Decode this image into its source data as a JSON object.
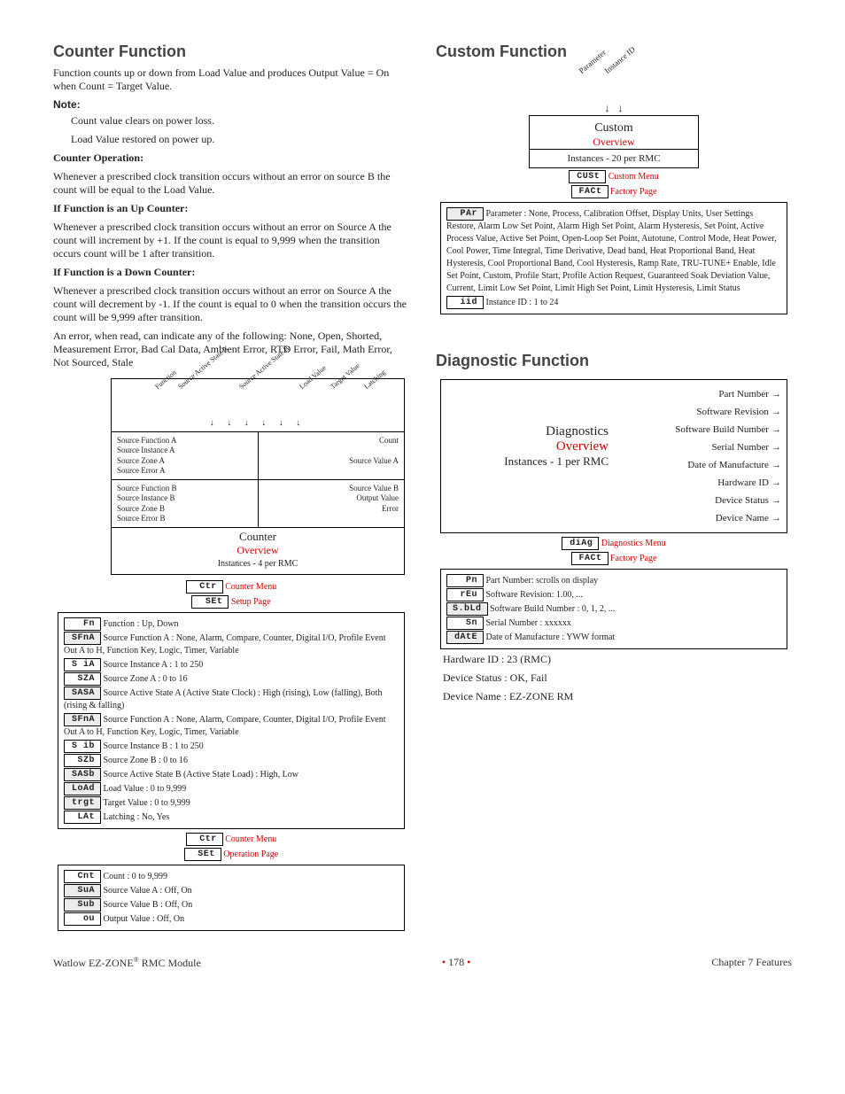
{
  "left": {
    "title": "Counter Function",
    "intro": "Function counts up or down from Load Value and produces Output Value = On when Count = Target Value.",
    "noteLabel": "Note:",
    "note1": "Count value clears on power loss.",
    "note2": "Load Value restored on power up.",
    "h1": "Counter Operation:",
    "p1": "Whenever a prescribed clock transition occurs without an error on source B the count will be equal to the Load Value.",
    "h2": "If Function is an Up Counter:",
    "p2": "Whenever a prescribed clock transition occurs without an error on Source A the count will increment by +1. If the count is equal to 9,999 when the transition occurs count will be 1 after transition.",
    "h3": "If Function is a Down Counter:",
    "p3": "Whenever a prescribed clock transition occurs without an error on Source A the count will decrement by -1. If the count is equal to 0 when the transition occurs the count will be 9,999 after transition.",
    "p4": "An error, when read, can indicate any of the following: None, Open, Shorted, Measurement Error, Bad Cal Data, Ambient Error, RTD Error, Fail, Math Error, Not Sourced, Stale",
    "diagram": {
      "topLabels": {
        "a": "Function",
        "b": "Source Active State A",
        "c": "Source Active State B",
        "d": "Load Value",
        "e": "Target Value",
        "f": "Latching"
      },
      "left1": "Source Function A\nSource Instance A\nSource Zone A\nSource Error A",
      "right1": "Count\n\nSource Value A",
      "left2": "Source Function B\nSource Instance B\nSource Zone B\nSource Error B",
      "right2": "Source Value B\nOutput Value\nError",
      "title": "Counter",
      "overview": "Overview",
      "instances": "Instances - 4 per RMC"
    },
    "menu1": {
      "seg1": "Ctr",
      "label1": "Counter Menu",
      "seg2": "SEt",
      "label2": "Setup Page"
    },
    "params1": {
      "r1": {
        "seg": "Fn",
        "txt": "Function : Up, Down"
      },
      "r2": {
        "seg": "SFnA",
        "txt": "Source Function A : None, Alarm, Compare, Counter, Digital I/O, Profile Event Out A to H, Function Key, Logic, Timer, Variable"
      },
      "r3": {
        "seg": "S iA",
        "txt": "Source Instance A : 1 to 250"
      },
      "r4": {
        "seg": "SZA",
        "txt": "Source Zone A : 0 to 16"
      },
      "r5": {
        "seg": "SASA",
        "txt": "Source Active State A (Active State Clock) : High (rising), Low (falling), Both (rising & falling)"
      },
      "r6": {
        "seg": "SFnA",
        "txt": "Source Function A : None, Alarm, Compare, Counter, Digital I/O, Profile Event Out A to H, Function Key, Logic, Timer, Variable"
      },
      "r7": {
        "seg": "S ib",
        "txt": "Source Instance B : 1 to 250"
      },
      "r8": {
        "seg": "SZb",
        "txt": "Source Zone B : 0 to 16"
      },
      "r9": {
        "seg": "SASb",
        "txt": "Source Active State B (Active State Load) : High, Low"
      },
      "r10": {
        "seg": "LoAd",
        "txt": "Load Value : 0 to 9,999"
      },
      "r11": {
        "seg": "trgt",
        "txt": "Target Value : 0 to 9,999"
      },
      "r12": {
        "seg": "LAt",
        "txt": "Latching : No, Yes"
      }
    },
    "menu2": {
      "seg1": "Ctr",
      "label1": "Counter Menu",
      "seg2": "SEt",
      "label2": "Operation Page"
    },
    "params2": {
      "r1": {
        "seg": "Cnt",
        "txt": "Count : 0 to 9,999"
      },
      "r2": {
        "seg": "SuA",
        "txt": "Source Value A : Off, On"
      },
      "r3": {
        "seg": "Sub",
        "txt": "Source Value B : Off, On"
      },
      "r4": {
        "seg": "ou",
        "txt": "Output Value : Off, On"
      }
    }
  },
  "right": {
    "custom": {
      "title": "Custom Function",
      "topLabels": {
        "a": "Parameter",
        "b": "Instance ID"
      },
      "boxTitle": "Custom",
      "overview": "Overview",
      "instances": "Instances - 20 per RMC",
      "menu": {
        "seg1": "CUSt",
        "label1": "Custom Menu",
        "seg2": "FACt",
        "label2": "Factory Page"
      },
      "params": {
        "r1": {
          "seg": "PAr",
          "txt": "Parameter : None,  Process, Calibration Offset, Display Units, User Settings Restore, Alarm Low Set Point, Alarm High Set Point, Alarm Hysteresis, Set Point, Active Process Value, Active Set Point, Open-Loop Set Point, Autotune, Control Mode, Heat Power, Cool Power, Time Integral, Time Derivative, Dead band, Heat Proportional Band, Heat Hysteresis, Cool Proportional Band, Cool Hysteresis, Ramp Rate, TRU-TUNE+ Enable, Idle Set Point, Custom, Profile Start, Profile Action Request, Guaranteed Soak Deviation Value, Current, Limit Low Set Point, Limit High Set Point, Limit Hysteresis, Limit Status"
        },
        "r2": {
          "seg": "iid",
          "txt": "Instance ID : 1 to 24"
        }
      }
    },
    "diag": {
      "title": "Diagnostic Function",
      "items": {
        "a": "Part Number",
        "b": "Software Revision",
        "c": "Software Build Number",
        "d": "Serial Number",
        "e": "Date of Manufacture",
        "f": "Hardware ID",
        "g": "Device Status",
        "h": "Device Name"
      },
      "leftBig": "Diagnostics",
      "overview": "Overview",
      "instances": "Instances - 1 per RMC",
      "menu": {
        "seg1": "diAg",
        "label1": "Diagnostics Menu",
        "seg2": "FACt",
        "label2": "Factory Page"
      },
      "params": {
        "r1": {
          "seg": "Pn",
          "txt": "Part Number: scrolls on display"
        },
        "r2": {
          "seg": "rEu",
          "txt": "Software Revision: 1.00, ..."
        },
        "r3": {
          "seg": "S.bLd",
          "txt": "Software Build Number : 0, 1, 2, ..."
        },
        "r4": {
          "seg": "Sn",
          "txt": "Serial Number : xxxxxx"
        },
        "r5": {
          "seg": "dAtE",
          "txt": " Date of Manufacture : YWW format"
        }
      },
      "extra1": "Hardware ID : 23 (RMC)",
      "extra2": "Device Status : OK, Fail",
      "extra3": "Device Name : EZ-ZONE RM"
    }
  },
  "footer": {
    "left": "Watlow EZ-ZONE",
    "leftSuffix": " RMC Module",
    "page": "178",
    "right": "Chapter 7 Features"
  }
}
